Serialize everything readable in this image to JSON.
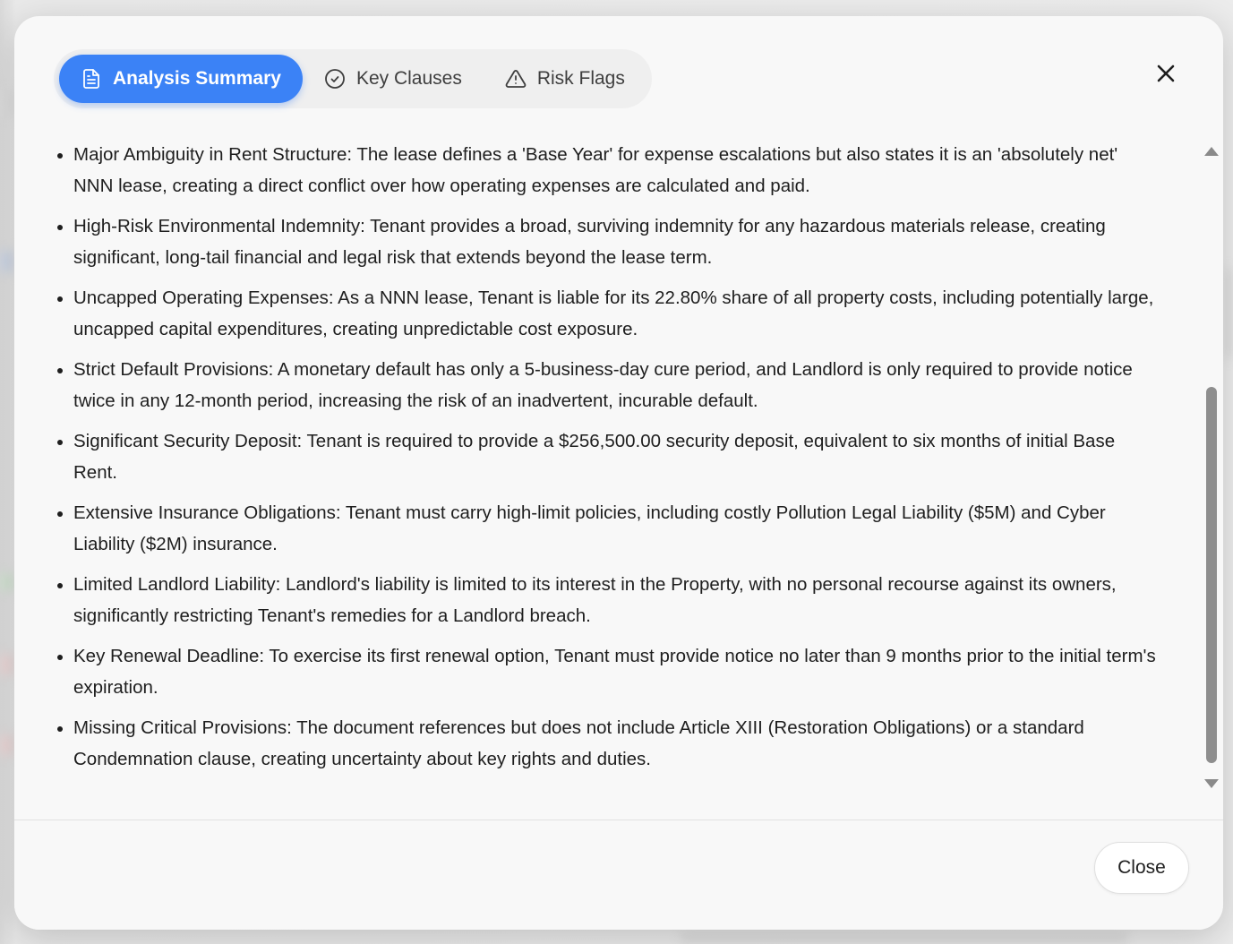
{
  "tabs": [
    {
      "label": "Analysis Summary",
      "icon": "document-icon",
      "active": true
    },
    {
      "label": "Key Clauses",
      "icon": "check-circle-icon",
      "active": false
    },
    {
      "label": "Risk Flags",
      "icon": "warning-triangle-icon",
      "active": false
    }
  ],
  "summary_items": [
    "Major Ambiguity in Rent Structure: The lease defines a 'Base Year' for expense escalations but also states it is an 'absolutely net' NNN lease, creating a direct conflict over how operating expenses are calculated and paid.",
    "High-Risk Environmental Indemnity: Tenant provides a broad, surviving indemnity for any hazardous materials release, creating significant, long-tail financial and legal risk that extends beyond the lease term.",
    "Uncapped Operating Expenses: As a NNN lease, Tenant is liable for its 22.80% share of all property costs, including potentially large, uncapped capital expenditures, creating unpredictable cost exposure.",
    "Strict Default Provisions: A monetary default has only a 5-business-day cure period, and Landlord is only required to provide notice twice in any 12-month period, increasing the risk of an inadvertent, incurable default.",
    "Significant Security Deposit: Tenant is required to provide a $256,500.00 security deposit, equivalent to six months of initial Base Rent.",
    "Extensive Insurance Obligations: Tenant must carry high-limit policies, including costly Pollution Legal Liability ($5M) and Cyber Liability ($2M) insurance.",
    "Limited Landlord Liability: Landlord's liability is limited to its interest in the Property, with no personal recourse against its owners, significantly restricting Tenant's remedies for a Landlord breach.",
    "Key Renewal Deadline: To exercise its first renewal option, Tenant must provide notice no later than 9 months prior to the initial term's expiration.",
    "Missing Critical Provisions: The document references but does not include Article XIII (Restoration Obligations) or a standard Condemnation clause, creating uncertainty about key rights and duties."
  ],
  "footer": {
    "close_label": "Close"
  },
  "colors": {
    "accent": "#3b82f6"
  }
}
